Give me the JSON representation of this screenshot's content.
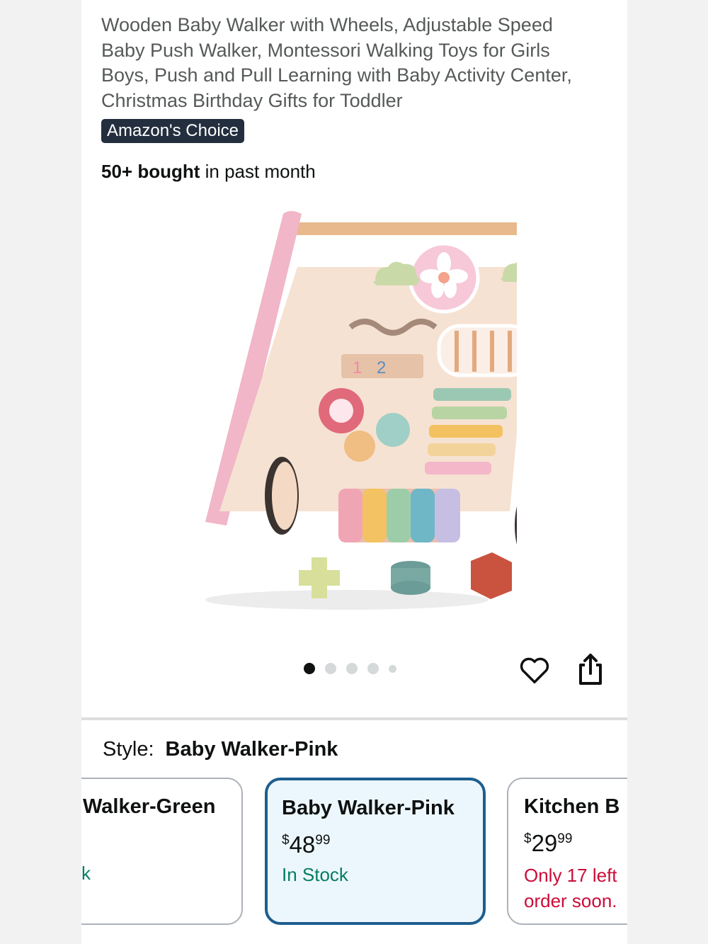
{
  "product": {
    "title": "Wooden Baby Walker with Wheels, Adjustable Speed Baby Push Walker, Montessori Walking Toys for Girls Boys, Push and Pull Learning with Baby Activity Center, Christmas Birthday Gifts for Toddler",
    "badge": "Amazon's Choice",
    "bought_count": "50+ bought",
    "bought_suffix": " in past month"
  },
  "gallery": {
    "dot_count": 5,
    "active_index": 0,
    "favorite_icon": "heart-icon",
    "share_icon": "share-icon"
  },
  "style": {
    "label": "Style:",
    "selected": "Baby Walker-Pink"
  },
  "options": [
    {
      "name": "Walker-Green",
      "stock": "k"
    },
    {
      "name": "Baby Walker-Pink",
      "price_symbol": "$",
      "price_whole": "48",
      "price_fraction": "99",
      "stock": "In Stock"
    },
    {
      "name": "Kitchen B",
      "price_symbol": "$",
      "price_whole": "29",
      "price_fraction": "99",
      "stock_line1": "Only 17 left",
      "stock_line2": "order soon."
    }
  ],
  "colors": {
    "badge_bg": "#232f3e",
    "selected_border": "#1d5e8e",
    "selected_bg": "#ecf7fd",
    "in_stock": "#067d62",
    "low_stock": "#cc0c39"
  }
}
